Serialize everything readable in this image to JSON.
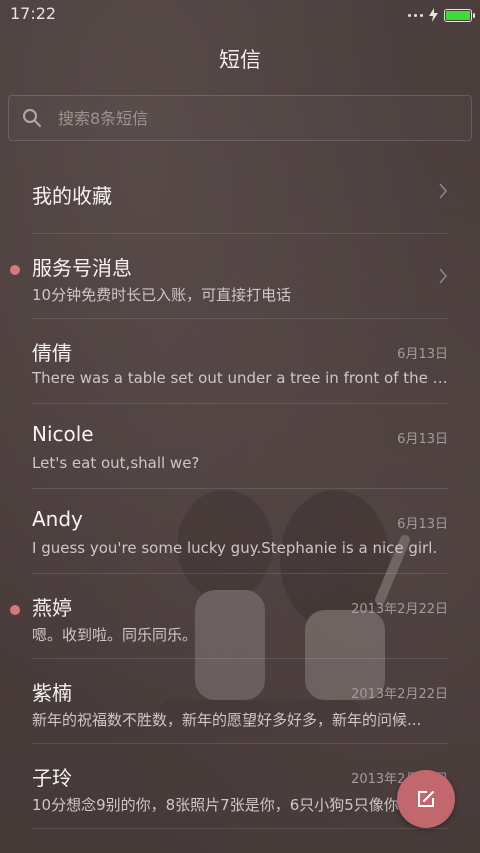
{
  "status_bar": {
    "time": "17:22"
  },
  "header": {
    "title": "短信"
  },
  "search": {
    "placeholder": "搜索8条短信"
  },
  "favorites": {
    "label": "我的收藏"
  },
  "conversations": [
    {
      "name": "服务号消息",
      "preview": "10分钟免费时长已入账，可直接打电话",
      "date": "",
      "unread": true,
      "chevron": true
    },
    {
      "name": "倩倩",
      "preview": "There was a table set out under a tree in front of the ho...",
      "date": "6月13日",
      "unread": false,
      "chevron": false
    },
    {
      "name": "Nicole",
      "preview": "Let's eat out,shall we?",
      "date": "6月13日",
      "unread": false,
      "chevron": false
    },
    {
      "name": "Andy",
      "preview": "I guess you're some lucky guy.Stephanie is a nice girl.",
      "date": "6月13日",
      "unread": false,
      "chevron": false
    },
    {
      "name": "燕婷",
      "preview": "嗯。收到啦。同乐同乐。",
      "date": "2013年2月22日",
      "unread": true,
      "chevron": false
    },
    {
      "name": "紫楠",
      "preview": "新年的祝福数不胜数，新年的愿望好多好多，新年的问候...",
      "date": "2013年2月22日",
      "unread": false,
      "chevron": false
    },
    {
      "name": "子玲",
      "preview": "10分想念9别的你，8张照片7张是你，6只小狗5只像你",
      "date": "2013年2月22日",
      "unread": false,
      "chevron": false
    }
  ],
  "colors": {
    "accent": "#c2676c",
    "unread_dot": "#d9787c",
    "battery": "#3ddc3d"
  },
  "icons": {
    "search": "search-icon",
    "compose": "compose-icon",
    "chevron": "chevron-right-icon"
  }
}
